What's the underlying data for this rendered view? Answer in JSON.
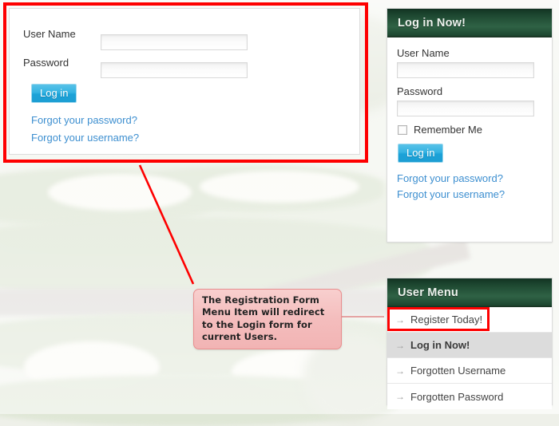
{
  "main_login_form": {
    "username_label": "User Name",
    "username_value": "",
    "password_label": "Password",
    "password_value": "",
    "login_button": "Log in",
    "forgot_password_link": "Forgot your password?",
    "forgot_username_link": "Forgot your username?"
  },
  "annotation": {
    "callout_line_1": "The Registration Form",
    "callout_line_2": "Menu Item will redirect",
    "callout_line_3": "to the Login form for",
    "callout_line_4": "current Users.",
    "highlight_color": "#fe0000",
    "callout_bg_color": "#f4bdbd",
    "connector_color": "#e5a3a3"
  },
  "sidebar": {
    "login_module": {
      "title": "Log in Now!",
      "username_label": "User Name",
      "username_value": "",
      "password_label": "Password",
      "password_value": "",
      "remember_me_label": "Remember Me",
      "remember_me_checked": false,
      "login_button": "Log in",
      "forgot_password_link": "Forgot your password?",
      "forgot_username_link": "Forgot your username?"
    },
    "user_menu_module": {
      "title": "User Menu",
      "items": [
        {
          "label": "Register Today!",
          "arrow": "→",
          "active": false,
          "highlighted": true
        },
        {
          "label": "Log in Now!",
          "arrow": "→",
          "active": true,
          "highlighted": false
        },
        {
          "label": "Forgotten Username",
          "arrow": "→",
          "active": false,
          "highlighted": false
        },
        {
          "label": "Forgotten Password",
          "arrow": "→",
          "active": false,
          "highlighted": false
        }
      ]
    }
  },
  "theme": {
    "header_green": "#2f6245",
    "button_blue": "#1ba2d8",
    "link_blue": "#3d8fd0"
  }
}
